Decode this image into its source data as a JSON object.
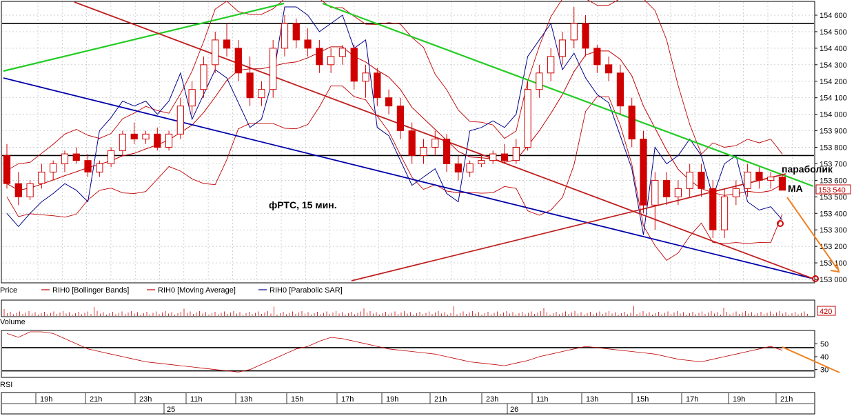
{
  "chart_data": {
    "type": "candlestick",
    "annotation": "фРТС,  15 мин.",
    "y_ticks": [
      153000,
      153100,
      153200,
      153300,
      153400,
      153500,
      153600,
      153700,
      153800,
      153900,
      154000,
      154100,
      154200,
      154300,
      154400,
      154500,
      154600
    ],
    "ylim": [
      153000,
      154650
    ],
    "last_price": "153 540",
    "horizontal_levels": [
      154550,
      153750
    ],
    "legend": [
      {
        "label": "Price",
        "color": "#c00000"
      },
      {
        "label": "RIH0 [Bollinger Bands]",
        "color": "#c00000"
      },
      {
        "label": "RIH0 [Moving Average]",
        "color": "#c00000"
      },
      {
        "label": "RIH0 [Parabolic SAR]",
        "color": "#00008b"
      }
    ],
    "labels": {
      "parabolic": "параболик",
      "ma": "MA"
    },
    "candles": [
      [
        153750,
        153820,
        153550,
        153580
      ],
      [
        153580,
        153650,
        153450,
        153500
      ],
      [
        153500,
        153600,
        153480,
        153580
      ],
      [
        153580,
        153700,
        153550,
        153650
      ],
      [
        153650,
        153720,
        153600,
        153700
      ],
      [
        153700,
        153780,
        153650,
        153760
      ],
      [
        153760,
        153800,
        153700,
        153720
      ],
      [
        153720,
        153760,
        153620,
        153650
      ],
      [
        153650,
        153720,
        153620,
        153700
      ],
      [
        153700,
        153800,
        153680,
        153780
      ],
      [
        153780,
        153900,
        153750,
        153880
      ],
      [
        153880,
        153950,
        153820,
        153850
      ],
      [
        153850,
        153900,
        153820,
        153880
      ],
      [
        153880,
        153920,
        153780,
        153800
      ],
      [
        153800,
        153900,
        153780,
        153880
      ],
      [
        153880,
        154100,
        153850,
        154050
      ],
      [
        154050,
        154200,
        154000,
        154150
      ],
      [
        154150,
        154350,
        154100,
        154300
      ],
      [
        154300,
        154500,
        154250,
        154450
      ],
      [
        154450,
        154550,
        154350,
        154400
      ],
      [
        154400,
        154450,
        154200,
        154250
      ],
      [
        154250,
        154350,
        154050,
        154100
      ],
      [
        154100,
        154200,
        154050,
        154150
      ],
      [
        154150,
        154450,
        154100,
        154400
      ],
      [
        154400,
        154600,
        154350,
        154550
      ],
      [
        154550,
        154580,
        154400,
        154450
      ],
      [
        154450,
        154520,
        154350,
        154400
      ],
      [
        154400,
        154450,
        154250,
        154300
      ],
      [
        154300,
        154400,
        154250,
        154350
      ],
      [
        154350,
        154420,
        154300,
        154400
      ],
      [
        154400,
        154420,
        154150,
        154200
      ],
      [
        154200,
        154300,
        154100,
        154250
      ],
      [
        154250,
        154280,
        154050,
        154100
      ],
      [
        154100,
        154150,
        154000,
        154050
      ],
      [
        154050,
        154100,
        153850,
        153900
      ],
      [
        153900,
        153950,
        153700,
        153750
      ],
      [
        153750,
        153850,
        153700,
        153800
      ],
      [
        153800,
        153900,
        153750,
        153850
      ],
      [
        153850,
        153880,
        153650,
        153700
      ],
      [
        153700,
        153750,
        153600,
        153650
      ],
      [
        153650,
        153720,
        153620,
        153700
      ],
      [
        153700,
        153760,
        153680,
        153720
      ],
      [
        153720,
        153780,
        153700,
        153760
      ],
      [
        153760,
        153820,
        153700,
        153720
      ],
      [
        153720,
        153850,
        153700,
        153800
      ],
      [
        153800,
        154200,
        153780,
        154150
      ],
      [
        154150,
        154300,
        154100,
        154250
      ],
      [
        154250,
        154400,
        154200,
        154350
      ],
      [
        154350,
        154500,
        154300,
        154450
      ],
      [
        154450,
        154650,
        154400,
        154550
      ],
      [
        154550,
        154600,
        154350,
        154400
      ],
      [
        154400,
        154420,
        154250,
        154300
      ],
      [
        154300,
        154350,
        154200,
        154250
      ],
      [
        154250,
        154300,
        154000,
        154050
      ],
      [
        154050,
        154100,
        153800,
        153850
      ],
      [
        153850,
        153900,
        153400,
        153450
      ],
      [
        153450,
        153650,
        153300,
        153600
      ],
      [
        153600,
        153650,
        153450,
        153500
      ],
      [
        153500,
        153600,
        153450,
        153550
      ],
      [
        153550,
        153700,
        153500,
        153650
      ],
      [
        153650,
        153700,
        153500,
        153550
      ],
      [
        153550,
        153600,
        153250,
        153300
      ],
      [
        153300,
        153550,
        153250,
        153500
      ],
      [
        153500,
        153600,
        153450,
        153550
      ],
      [
        153550,
        153700,
        153500,
        153650
      ],
      [
        153650,
        153680,
        153550,
        153600
      ],
      [
        153600,
        153650,
        153550,
        153620
      ],
      [
        153620,
        153640,
        153540,
        153540
      ]
    ],
    "volume_label": "Volume",
    "volume_last": "420",
    "rsi_label": "RSI",
    "rsi_ticks": [
      30,
      40,
      50
    ],
    "rsi_levels": [
      47,
      29
    ],
    "rsi_values": [
      58,
      55,
      60,
      62,
      58,
      54,
      50,
      46,
      44,
      42,
      40,
      38,
      36,
      35,
      34,
      33,
      32,
      31,
      30,
      29,
      28,
      30,
      34,
      38,
      42,
      46,
      48,
      52,
      55,
      54,
      52,
      50,
      48,
      46,
      45,
      44,
      43,
      42,
      40,
      38,
      36,
      35,
      34,
      33,
      35,
      37,
      40,
      42,
      44,
      46,
      48,
      47,
      46,
      45,
      44,
      43,
      42,
      40,
      38,
      37,
      36,
      38,
      40,
      42,
      44,
      46,
      48,
      45
    ],
    "time_labels": [
      "19h",
      "21h",
      "23h",
      "11h",
      "13h",
      "15h",
      "17h",
      "19h",
      "21h",
      "23h",
      "11h",
      "13h",
      "15h",
      "17h",
      "19h",
      "21h"
    ],
    "date_labels": [
      "25",
      "26"
    ],
    "colors": {
      "price": "#d00000",
      "band": "#c00000",
      "sar": "#00008b",
      "green": "#22cc22",
      "orange": "#f08020",
      "grid": "#bdbdbd"
    }
  }
}
